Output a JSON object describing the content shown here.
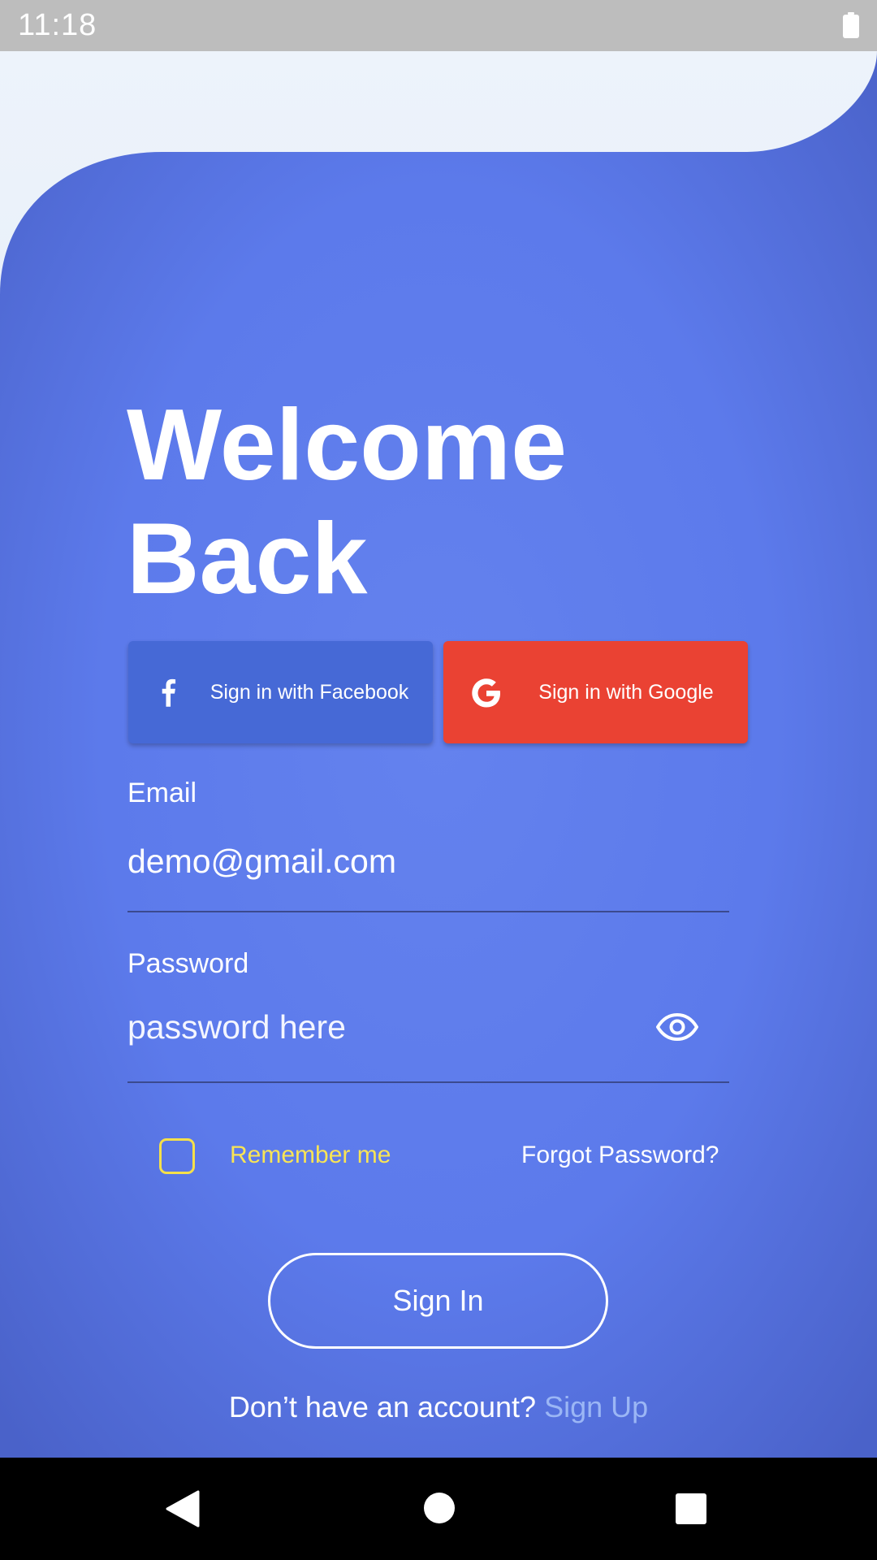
{
  "status_bar": {
    "time": "11:18",
    "battery_icon": "battery-full-icon"
  },
  "title": "Welcome\nBack",
  "social": {
    "facebook_label": "Sign in with Facebook",
    "facebook_icon": "facebook-icon",
    "google_label": "Sign in with Google",
    "google_icon": "google-icon"
  },
  "email": {
    "label": "Email",
    "value": "demo@gmail.com"
  },
  "password": {
    "label": "Password",
    "placeholder": "password here",
    "toggle_icon": "eye-icon"
  },
  "remember": {
    "label": "Remember me",
    "checked": false
  },
  "forgot_label": "Forgot Password?",
  "sign_in_label": "Sign In",
  "signup": {
    "prompt": "Don’t have an account?",
    "link": "Sign Up"
  },
  "nav": {
    "back_icon": "back-triangle-icon",
    "home_icon": "home-circle-icon",
    "recents_icon": "recents-square-icon"
  },
  "colors": {
    "background_blue": "#5f7ded",
    "facebook": "#4669d6",
    "google": "#ea4233",
    "remember_accent": "#f5e04a",
    "signup_link": "#9bb6f5"
  }
}
